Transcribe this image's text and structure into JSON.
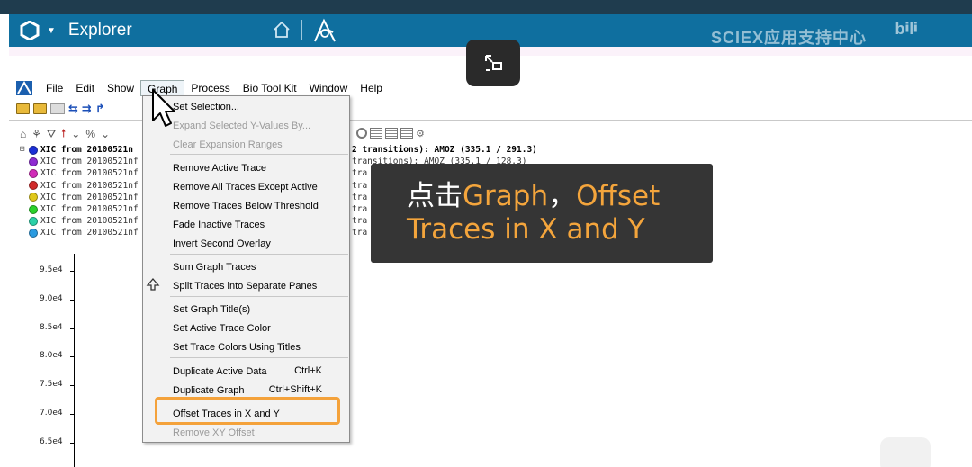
{
  "app": {
    "title": "Explorer",
    "watermark": "SCIEX应用支持中心",
    "bili_mark": "bilibili"
  },
  "menubar": [
    "File",
    "Edit",
    "Show",
    "Graph",
    "Process",
    "Bio Tool Kit",
    "Window",
    "Help"
  ],
  "legend": {
    "first": "XIC from 20100521n",
    "rows": [
      {
        "label": "XIC from 20100521nf",
        "color": "#8e2bd1"
      },
      {
        "label": "XIC from 20100521nf",
        "color": "#d12bb8"
      },
      {
        "label": "XIC from 20100521nf",
        "color": "#d12b2b"
      },
      {
        "label": "XIC from 20100521nf",
        "color": "#e0c81a"
      },
      {
        "label": "XIC from 20100521nf",
        "color": "#2bd12b"
      },
      {
        "label": "XIC from 20100521nf",
        "color": "#2bd1a8"
      },
      {
        "label": "XIC from 20100521nf",
        "color": "#2b9be0"
      }
    ],
    "first_color": "#1b2fd6",
    "right_first": "2 transitions): AMOZ (335.1 / 291.3)",
    "right_second": "transitions): AMOZ (335.1 / 128.3)",
    "right_rest": [
      "tra",
      "tra",
      "tra",
      "tra",
      "tra",
      "tra"
    ]
  },
  "yaxis": [
    "9.5e4",
    "9.0e4",
    "8.5e4",
    "8.0e4",
    "7.5e4",
    "7.0e4",
    "6.5e4"
  ],
  "graph_menu": {
    "items": [
      {
        "label": "Set Selection...",
        "disabled": false
      },
      {
        "label": "Expand Selected Y-Values By...",
        "disabled": true
      },
      {
        "label": "Clear Expansion Ranges",
        "disabled": true
      },
      {
        "label": "Remove Active Trace",
        "disabled": false
      },
      {
        "label": "Remove All Traces Except Active",
        "disabled": false
      },
      {
        "label": "Remove Traces Below Threshold",
        "disabled": false
      },
      {
        "label": "Fade Inactive Traces",
        "disabled": false
      },
      {
        "label": "Invert Second Overlay",
        "disabled": false
      },
      {
        "label": "Sum Graph Traces",
        "disabled": false
      },
      {
        "label": "Split Traces into Separate Panes",
        "disabled": false
      },
      {
        "label": "Set Graph Title(s)",
        "disabled": false
      },
      {
        "label": "Set Active Trace Color",
        "disabled": false
      },
      {
        "label": "Set Trace Colors Using Titles",
        "disabled": false
      },
      {
        "label": "Duplicate Active Data",
        "disabled": false,
        "shortcut": "Ctrl+K"
      },
      {
        "label": "Duplicate Graph",
        "disabled": false,
        "shortcut": "Ctrl+Shift+K"
      },
      {
        "label": "Offset Traces in X and Y",
        "disabled": false
      },
      {
        "label": "Remove XY Offset",
        "disabled": true
      }
    ]
  },
  "caption": {
    "line1_prefix": "点击",
    "line1_graph": "Graph",
    "line1_comma": "，",
    "line1_offset": "Offset",
    "line2": "Traces in X and Y"
  },
  "colors": {
    "app_bar": "#0f6f9f",
    "highlight": "#f4a23b",
    "caption_accent": "#f4a53c"
  }
}
